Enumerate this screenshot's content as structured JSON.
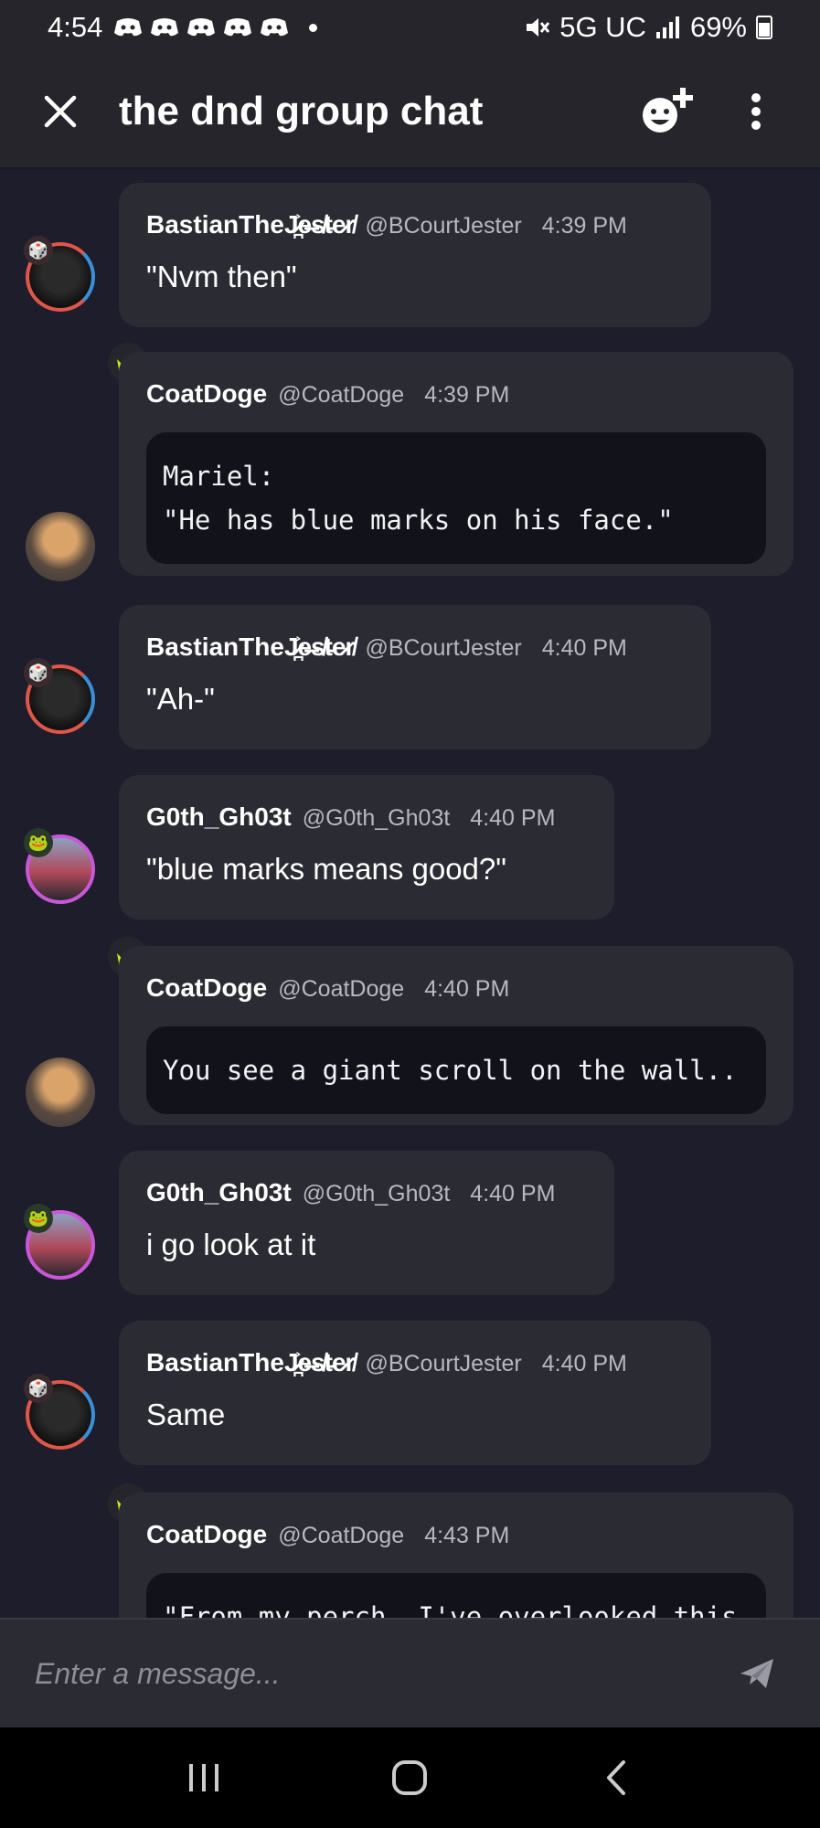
{
  "status_bar": {
    "time": "4:54",
    "network": "5G UC",
    "battery": "69%"
  },
  "header": {
    "title": "the dnd group chat",
    "close_icon": "close-icon",
    "add_reaction_icon": "add-emoji-icon",
    "more_icon": "more-vertical-icon"
  },
  "messages": [
    {
      "user": "BastianThe",
      "user_suffix": "J̷̪͐e̶s̸t̵e̷r̸",
      "handle": "@BCourtJester",
      "time": "4:39 PM",
      "text": "\"Nvm then\"",
      "avatar": "jester",
      "code": false
    },
    {
      "user": "CoatDoge",
      "user_suffix": "",
      "handle": "@CoatDoge",
      "time": "4:39 PM",
      "text": "Mariel:\n\"He has blue marks on his face.\"",
      "avatar": "doge",
      "code": true,
      "crown": true
    },
    {
      "user": "BastianThe",
      "user_suffix": "J̷̪͐e̶s̸t̵e̷r̸",
      "handle": "@BCourtJester",
      "time": "4:40 PM",
      "text": "\"Ah-\"",
      "avatar": "jester",
      "code": false
    },
    {
      "user": "G0th_Gh03t",
      "user_suffix": "",
      "handle": "@G0th_Gh03t",
      "time": "4:40 PM",
      "text": "\"blue marks means good?\"",
      "avatar": "ghost",
      "code": false
    },
    {
      "user": "CoatDoge",
      "user_suffix": "",
      "handle": "@CoatDoge",
      "time": "4:40 PM",
      "text": "You see a giant scroll on the wall..",
      "avatar": "doge",
      "code": true,
      "crown": true
    },
    {
      "user": "G0th_Gh03t",
      "user_suffix": "",
      "handle": "@G0th_Gh03t",
      "time": "4:40 PM",
      "text": "i go look at it",
      "avatar": "ghost",
      "code": false
    },
    {
      "user": "BastianThe",
      "user_suffix": "J̷̪͐e̶s̸t̵e̷r̸",
      "handle": "@BCourtJester",
      "time": "4:40 PM",
      "text": "Same",
      "avatar": "jester",
      "code": false
    },
    {
      "user": "CoatDoge",
      "user_suffix": "",
      "handle": "@CoatDoge",
      "time": "4:43 PM",
      "text": "\"From my perch, I've overlooked this",
      "avatar": "doge",
      "code": true,
      "crown": true
    }
  ],
  "composer": {
    "placeholder": "Enter a message...",
    "send_icon": "send-icon"
  },
  "nav": {
    "recents_icon": "recents-icon",
    "home_icon": "home-icon",
    "back_icon": "back-icon"
  }
}
